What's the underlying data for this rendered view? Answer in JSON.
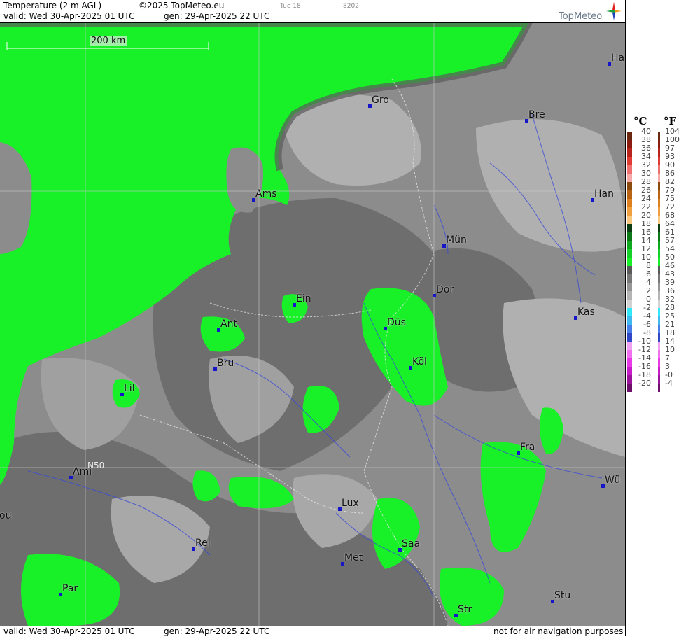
{
  "header": {
    "product": "Temperature (2 m AGL)",
    "copyright": "©2025 TopMeteo.eu",
    "run_label": "Tue 18",
    "code": "8202",
    "valid": "valid:  Wed  30-Apr-2025  01 UTC",
    "gen": "gen: 29-Apr-2025 22 UTC",
    "brand": "TopMeteo"
  },
  "footer": {
    "valid": "valid:  Wed  30-Apr-2025  01 UTC",
    "gen": "gen: 29-Apr-2025 22 UTC",
    "notice": "not for air navigation purposes"
  },
  "scale_bar": {
    "label": "200 km"
  },
  "grid_label": "N50",
  "legend": {
    "unit_c": "°C",
    "unit_f": "°F",
    "rows": [
      {
        "c": "40",
        "f": "104",
        "cc": "#6a2810",
        "fc": "#6a2810"
      },
      {
        "c": "38",
        "f": "100",
        "cc": "#8c1c10",
        "fc": "#8c1c10"
      },
      {
        "c": "36",
        "f": "97",
        "cc": "#b8241c",
        "fc": "#b8241c"
      },
      {
        "c": "34",
        "f": "93",
        "cc": "#e03c34",
        "fc": "#e03c34"
      },
      {
        "c": "32",
        "f": "90",
        "cc": "#f07070",
        "fc": "#f07070"
      },
      {
        "c": "30",
        "f": "86",
        "cc": "#f6a8a8",
        "fc": "#f6a8a8"
      },
      {
        "c": "28",
        "f": "82",
        "cc": "#8c4c10",
        "fc": "#8c4c10"
      },
      {
        "c": "26",
        "f": "79",
        "cc": "#b86414",
        "fc": "#b86414"
      },
      {
        "c": "24",
        "f": "75",
        "cc": "#dc8020",
        "fc": "#dc8020"
      },
      {
        "c": "22",
        "f": "72",
        "cc": "#f0a040",
        "fc": "#f0a040"
      },
      {
        "c": "20",
        "f": "68",
        "cc": "#f8c880",
        "fc": "#f8c880"
      },
      {
        "c": "18",
        "f": "64",
        "cc": "#0c4014",
        "fc": "#0c4014"
      },
      {
        "c": "16",
        "f": "61",
        "cc": "#0c7818",
        "fc": "#0c7818"
      },
      {
        "c": "14",
        "f": "57",
        "cc": "#10a820",
        "fc": "#10a820"
      },
      {
        "c": "12",
        "f": "54",
        "cc": "#14d028",
        "fc": "#14d028"
      },
      {
        "c": "10",
        "f": "50",
        "cc": "#18f028",
        "fc": "#18f028"
      },
      {
        "c": "8",
        "f": "46",
        "cc": "#5a5a5a",
        "fc": "#5a5a5a"
      },
      {
        "c": "6",
        "f": "43",
        "cc": "#787878",
        "fc": "#787878"
      },
      {
        "c": "4",
        "f": "39",
        "cc": "#969696",
        "fc": "#969696"
      },
      {
        "c": "2",
        "f": "36",
        "cc": "#b4b4b4",
        "fc": "#b4b4b4"
      },
      {
        "c": "0",
        "f": "32",
        "cc": "#d2d2d2",
        "fc": "#d2d2d2"
      },
      {
        "c": "-2",
        "f": "28",
        "cc": "#30e8f8",
        "fc": "#30e8f8"
      },
      {
        "c": "-4",
        "f": "25",
        "cc": "#40b8f0",
        "fc": "#40b8f0"
      },
      {
        "c": "-6",
        "f": "21",
        "cc": "#4880e8",
        "fc": "#4880e8"
      },
      {
        "c": "-8",
        "f": "18",
        "cc": "#3048c8",
        "fc": "#3048c8"
      },
      {
        "c": "-10",
        "f": "14",
        "cc": "#f0a0f0",
        "fc": "#f0a0f0"
      },
      {
        "c": "-12",
        "f": "10",
        "cc": "#f070f0",
        "fc": "#f070f0"
      },
      {
        "c": "-14",
        "f": "7",
        "cc": "#e838e8",
        "fc": "#e838e8"
      },
      {
        "c": "-16",
        "f": "3",
        "cc": "#c81cc8",
        "fc": "#c81cc8"
      },
      {
        "c": "-18",
        "f": "-0",
        "cc": "#9c149c",
        "fc": "#9c149c"
      },
      {
        "c": "-20",
        "f": "-4",
        "cc": "#6c106c",
        "fc": "#6c106c"
      }
    ]
  },
  "colors": {
    "sea_green": "#18f028",
    "land_dark": "#6e6e6e",
    "land_mid": "#8c8c8c",
    "land_light": "#b0b0b0",
    "land_pale": "#c8c8c8",
    "city_dot": "#1616c8",
    "river": "#3a4ad8"
  },
  "cities": [
    {
      "name": "Ha"
    },
    {
      "name": "Gro"
    },
    {
      "name": "Bre"
    },
    {
      "name": "Han"
    },
    {
      "name": "Ams"
    },
    {
      "name": "Mün"
    },
    {
      "name": "Dor"
    },
    {
      "name": "Ein"
    },
    {
      "name": "Kas"
    },
    {
      "name": "Ant"
    },
    {
      "name": "Düs"
    },
    {
      "name": "Köl"
    },
    {
      "name": "Bru"
    },
    {
      "name": "Lil"
    },
    {
      "name": "Fra"
    },
    {
      "name": "Ami"
    },
    {
      "name": "Wü"
    },
    {
      "name": "Lux"
    },
    {
      "name": "ou"
    },
    {
      "name": "Rei"
    },
    {
      "name": "Saa"
    },
    {
      "name": "Met"
    },
    {
      "name": "Par"
    },
    {
      "name": "Stu"
    },
    {
      "name": "Str"
    }
  ]
}
